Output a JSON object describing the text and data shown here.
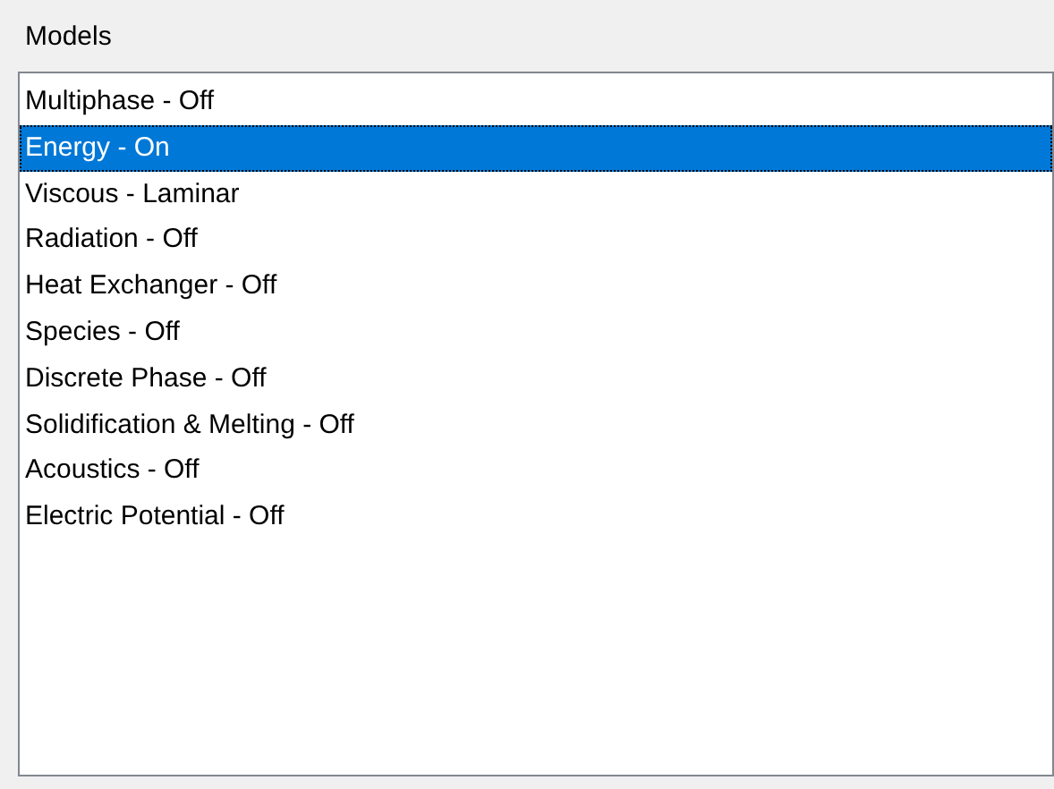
{
  "group": {
    "title": "Models"
  },
  "models": [
    {
      "label": "Multiphase - Off",
      "selected": false
    },
    {
      "label": "Energy - On",
      "selected": true
    },
    {
      "label": "Viscous - Laminar",
      "selected": false
    },
    {
      "label": "Radiation - Off",
      "selected": false
    },
    {
      "label": "Heat Exchanger - Off",
      "selected": false
    },
    {
      "label": "Species - Off",
      "selected": false
    },
    {
      "label": "Discrete Phase - Off",
      "selected": false
    },
    {
      "label": "Solidification & Melting - Off",
      "selected": false
    },
    {
      "label": "Acoustics - Off",
      "selected": false
    },
    {
      "label": "Electric Potential - Off",
      "selected": false
    }
  ]
}
